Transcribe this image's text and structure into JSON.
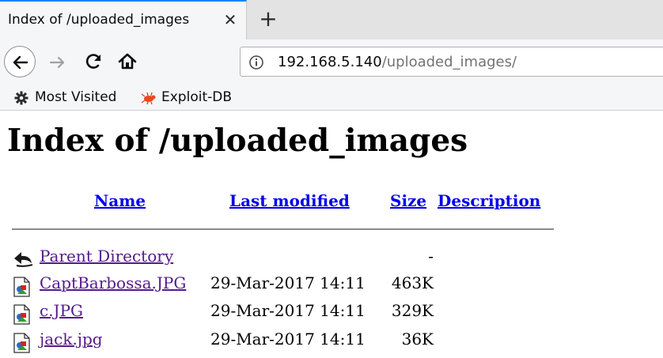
{
  "browser": {
    "tab_title": "Index of /uploaded_images",
    "tab_close": "✕",
    "new_tab": "+",
    "url_host": "192.168.5.140",
    "url_path": "/uploaded_images/",
    "bookmarks": [
      {
        "label": "Most Visited",
        "icon": "gear-icon"
      },
      {
        "label": "Exploit-DB",
        "icon": "exploit-db-icon"
      }
    ]
  },
  "page": {
    "heading": "Index of /uploaded_images",
    "columns": {
      "name": "Name",
      "last_modified": "Last modified",
      "size": "Size",
      "description": "Description"
    },
    "rows": [
      {
        "name": "Parent Directory",
        "date": "",
        "size": "-",
        "icon": "back-arrow-icon"
      },
      {
        "name": "CaptBarbossa.JPG",
        "date": "29-Mar-2017 14:11",
        "size": "463K",
        "icon": "image-file-icon"
      },
      {
        "name": "c.JPG",
        "date": "29-Mar-2017 14:11",
        "size": "329K",
        "icon": "image-file-icon"
      },
      {
        "name": "jack.jpg",
        "date": "29-Mar-2017 14:11",
        "size": "36K",
        "icon": "image-file-icon"
      }
    ]
  },
  "colors": {
    "link": "#0000ee",
    "visited_link": "#551a8b",
    "tab_accent": "#0a84ff"
  }
}
